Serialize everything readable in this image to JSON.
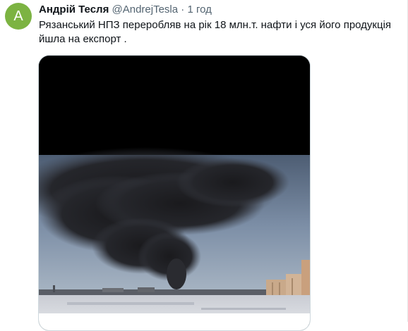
{
  "tweet": {
    "avatar_letter": "A",
    "author_name": "Андрій Тесля",
    "author_handle": "@AndrejTesla",
    "separator": "·",
    "time": "1 год",
    "text": "Рязанський НПЗ переробляв на рік 18 млн.т. нафти і уся його продукція йшла на експорт ."
  },
  "media": {
    "icon": "photo-smoke-over-refinery"
  },
  "colors": {
    "avatar_bg": "#7cb342",
    "text": "#0f1419",
    "muted": "#536471",
    "media_bg": "#000000"
  }
}
